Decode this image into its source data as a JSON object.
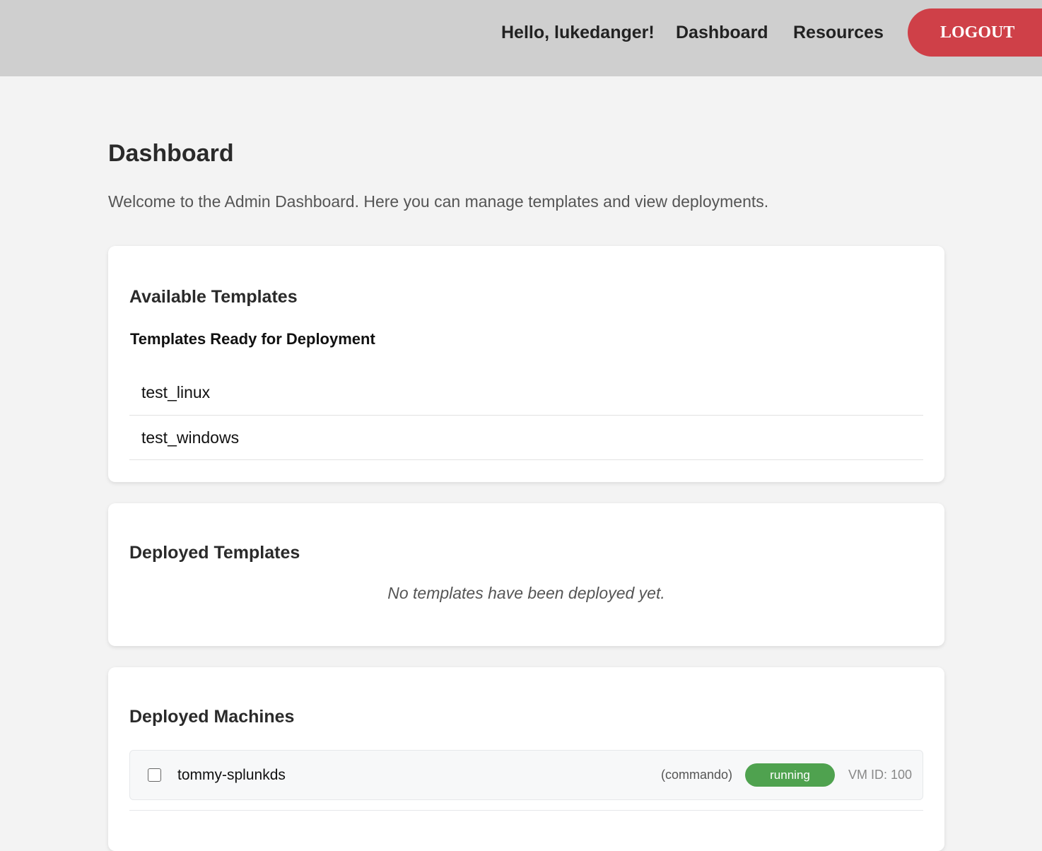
{
  "header": {
    "greeting": "Hello, lukedanger!",
    "nav_dashboard": "Dashboard",
    "nav_resources": "Resources",
    "logout_label": "LOGOUT",
    "logout_color": "#cf4048",
    "bar_color": "#cfcfcf"
  },
  "main": {
    "title": "Dashboard",
    "intro": "Welcome to the Admin Dashboard. Here you can manage templates and view deployments."
  },
  "available_templates": {
    "title": "Available Templates",
    "subheading": "Templates Ready for Deployment",
    "items": [
      {
        "name": "test_linux"
      },
      {
        "name": "test_windows"
      }
    ]
  },
  "deployed_templates": {
    "title": "Deployed Templates",
    "empty_message": "No templates have been deployed yet."
  },
  "deployed_machines": {
    "title": "Deployed Machines",
    "machines": [
      {
        "name": "tommy-splunkds",
        "template": "(commando)",
        "status": "running",
        "status_color": "#4fa24f",
        "vm_id": "VM ID: 100",
        "checked": false
      }
    ]
  }
}
